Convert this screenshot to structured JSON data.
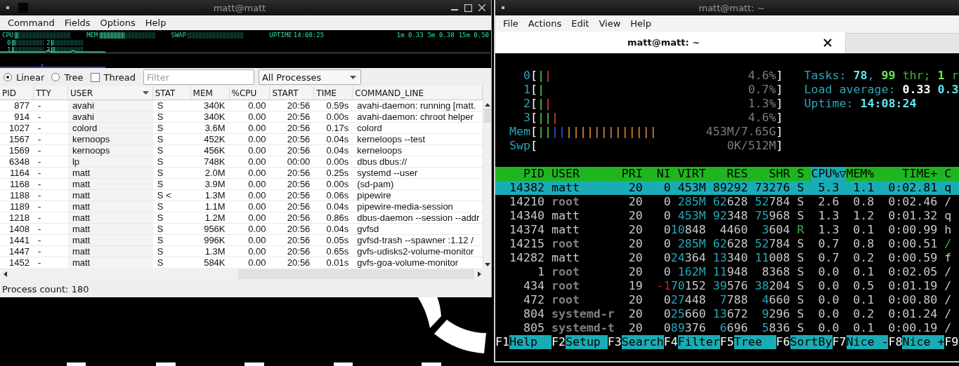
{
  "left_window": {
    "title": "matt@matt",
    "menu": [
      "Command",
      "Fields",
      "Options",
      "Help"
    ],
    "monitor": {
      "meters": [
        {
          "label": "CPU",
          "level": 0.06
        },
        {
          "label": "MEM",
          "level": 0.45
        },
        {
          "label": "SWAP"
        }
      ],
      "uptime_label": "UPTIME",
      "uptime": "14:08:25",
      "load": [
        "1m 0.33",
        "5m 0.38",
        "15m 0.50"
      ],
      "cores": [
        {
          "label": "0",
          "level": 0.1
        },
        {
          "label": "1",
          "level": 0.05
        },
        {
          "label": "2",
          "level": 0.08
        },
        {
          "label": "3",
          "level": 0.1
        }
      ]
    },
    "view_modes": [
      {
        "label": "Linear",
        "selected": true
      },
      {
        "label": "Tree",
        "selected": false
      }
    ],
    "thread": {
      "label": "Thread",
      "checked": false
    },
    "filter": {
      "placeholder": "Filter"
    },
    "process_filter": "All Processes",
    "table": {
      "columns": [
        {
          "label": "PID",
          "sorted": false
        },
        {
          "label": "TTY",
          "sorted": false
        },
        {
          "label": "USER",
          "sorted": true
        },
        {
          "label": "STAT",
          "sorted": false
        },
        {
          "label": "MEM",
          "sorted": false
        },
        {
          "label": "%CPU",
          "sorted": false
        },
        {
          "label": "START",
          "sorted": false
        },
        {
          "label": "TIME",
          "sorted": false
        },
        {
          "label": "COMMAND_LINE",
          "sorted": false
        }
      ],
      "rows": [
        [
          "877",
          "-",
          "avahi",
          "S",
          "340K",
          "0.00",
          "20:56",
          "0.59s",
          "avahi-daemon: running [matt."
        ],
        [
          "914",
          "-",
          "avahi",
          "S",
          "340K",
          "0.00",
          "20:56",
          "0.00s",
          "avahi-daemon: chroot helper"
        ],
        [
          "1027",
          "-",
          "colord",
          "S",
          "3.6M",
          "0.00",
          "20:56",
          "0.17s",
          "colord"
        ],
        [
          "1567",
          "-",
          "kernoops",
          "S",
          "452K",
          "0.00",
          "20:56",
          "0.04s",
          "kerneloops --test"
        ],
        [
          "1569",
          "-",
          "kernoops",
          "S",
          "456K",
          "0.00",
          "20:56",
          "0.04s",
          "kerneloops"
        ],
        [
          "6348",
          "-",
          "lp",
          "S",
          "748K",
          "0.00",
          "00:00",
          "0.00s",
          "dbus dbus://"
        ],
        [
          "1164",
          "-",
          "matt",
          "S",
          "2.0M",
          "0.00",
          "20:56",
          "0.25s",
          "systemd --user"
        ],
        [
          "1168",
          "-",
          "matt",
          "S",
          "3.9M",
          "0.00",
          "20:56",
          "0.00s",
          "(sd-pam)"
        ],
        [
          "1188",
          "-",
          "matt",
          "S <",
          "1.3M",
          "0.00",
          "20:56",
          "0.06s",
          "pipewire"
        ],
        [
          "1189",
          "-",
          "matt",
          "S",
          "1.1M",
          "0.00",
          "20:56",
          "0.04s",
          "pipewire-media-session"
        ],
        [
          "1218",
          "-",
          "matt",
          "S",
          "1.2M",
          "0.00",
          "20:56",
          "0.86s",
          "dbus-daemon --session --addr"
        ],
        [
          "1408",
          "-",
          "matt",
          "S",
          "956K",
          "0.00",
          "20:56",
          "0.04s",
          "gvfsd"
        ],
        [
          "1441",
          "-",
          "matt",
          "S",
          "996K",
          "0.00",
          "20:56",
          "0.05s",
          "gvfsd-trash --spawner :1.12 /"
        ],
        [
          "1447",
          "-",
          "matt",
          "S",
          "1.3M",
          "0.00",
          "20:56",
          "0.65s",
          "gvfs-udisks2-volume-monitor"
        ],
        [
          "1452",
          "-",
          "matt",
          "S",
          "584K",
          "0.00",
          "20:56",
          "0.01s",
          "gvfs-goa-volume-monitor"
        ]
      ]
    },
    "status": "Process count: 180"
  },
  "right_window": {
    "title": "matt@matt: ~",
    "menu": [
      "File",
      "Actions",
      "Edit",
      "View",
      "Help"
    ],
    "tabs": [
      {
        "label": "matt@matt: ~",
        "selected": true
      },
      {
        "selected": false
      }
    ],
    "htop": {
      "meters": [
        {
          "label": "0",
          "open": "[",
          "bars": [
            {
              "text": "|",
              "color": "#3cb43c"
            },
            {
              "text": "|",
              "color": "#c8322d"
            }
          ],
          "value": "4.6%",
          "close": "]"
        },
        {
          "label": "1",
          "open": "[",
          "bars": [
            {
              "text": "|",
              "color": "#3cb43c"
            }
          ],
          "value": "0.7%",
          "close": "]"
        },
        {
          "label": "2",
          "open": "[",
          "bars": [
            {
              "text": "|",
              "color": "#3cb43c"
            },
            {
              "text": "|",
              "color": "#c8322d"
            }
          ],
          "value": "1.3%",
          "close": "]"
        },
        {
          "label": "3",
          "open": "[",
          "bars": [
            {
              "text": "||",
              "color": "#3cb43c"
            },
            {
              "text": "|",
              "color": "#c8322d"
            }
          ],
          "value": "4.6%",
          "close": "]"
        },
        {
          "label": "Mem",
          "open": "[",
          "bars": [
            {
              "text": "||",
              "color": "#3cb43c"
            },
            {
              "text": "||",
              "color": "#2f3fd0"
            },
            {
              "text": "|||||||||||||",
              "color": "#c27a2c"
            }
          ],
          "value": "453M/7.65G",
          "close": "]"
        },
        {
          "label": "Swp",
          "open": "[",
          "value": "0K/512M",
          "close": "]"
        }
      ],
      "info": [
        [
          {
            "text": "Tasks: ",
            "color": "#2aa5b5",
            "bold": false
          },
          {
            "text": "78",
            "color": "#5ee8f0",
            "bold": true
          },
          {
            "text": ", ",
            "color": "#2aa5b5",
            "bold": false
          },
          {
            "text": "99",
            "color": "#6ee35a",
            "bold": true
          },
          {
            "text": " thr; ",
            "color": "#3cb43c",
            "bold": false
          },
          {
            "text": "1",
            "color": "#6ee35a",
            "bold": true
          },
          {
            "text": " r",
            "color": "#3cb43c",
            "bold": false
          }
        ],
        [
          {
            "text": "Load average: ",
            "color": "#2aa5b5",
            "bold": false
          },
          {
            "text": "0.33",
            "color": "#ffffff",
            "bold": true
          },
          {
            "text": " 0.3",
            "color": "#5ee8f0",
            "bold": true
          }
        ],
        [
          {
            "text": "Uptime: ",
            "color": "#2aa5b5",
            "bold": false
          },
          {
            "text": "14:08:24",
            "color": "#5ee8f0",
            "bold": true
          }
        ]
      ],
      "header": [
        {
          "label": "PID",
          "selected": false
        },
        {
          "label": "USER",
          "selected": false
        },
        {
          "label": "PRI",
          "selected": false
        },
        {
          "label": "NI",
          "selected": false
        },
        {
          "label": "VIRT",
          "selected": false
        },
        {
          "label": "RES",
          "selected": false
        },
        {
          "label": "SHR",
          "selected": false
        },
        {
          "label": "S",
          "selected": false
        },
        {
          "label": "CPU%▽",
          "selected": true
        },
        {
          "label": "MEM%",
          "selected": false
        },
        {
          "label": "TIME+",
          "selected": false
        },
        {
          "label": "C",
          "selected": false
        }
      ],
      "processes": [
        {
          "selected": true,
          "pid": "14382",
          "user": "matt",
          "pri": "20",
          "ni": "0",
          "virt": {
            "lo": "453M"
          },
          "res": {
            "lo": "89292"
          },
          "shr": {
            "lo": "73276"
          },
          "s": "S",
          "cpu": "5.3",
          "mem": "1.1",
          "time": "0:02.81",
          "cmd": "q"
        },
        {
          "selected": false,
          "dim_user": true,
          "running": false,
          "negative_nice": false,
          "cmd_highlight": false,
          "pid": "14210",
          "user": "root",
          "pri": "20",
          "ni": "0",
          "virt": {
            "hi": "285M"
          },
          "res": {
            "hi": "62",
            "lo": "628"
          },
          "shr": {
            "hi": "52",
            "lo": "784"
          },
          "s": "S",
          "cpu": "2.6",
          "mem": "0.8",
          "time": "0:02.46",
          "cmd": "/"
        },
        {
          "selected": false,
          "dim_user": false,
          "running": false,
          "negative_nice": false,
          "cmd_highlight": false,
          "pid": "14340",
          "user": "matt",
          "pri": "20",
          "ni": "0",
          "virt": {
            "hi": "453M"
          },
          "res": {
            "hi": "92",
            "lo": "348"
          },
          "shr": {
            "hi": "75",
            "lo": "968"
          },
          "s": "S",
          "cpu": "1.3",
          "mem": "1.2",
          "time": "0:01.32",
          "cmd": "q"
        },
        {
          "selected": false,
          "dim_user": false,
          "running": true,
          "negative_nice": false,
          "cmd_highlight": false,
          "pid": "14374",
          "user": "matt",
          "pri": "20",
          "ni": "0",
          "virt": {
            "hi": "10",
            "lo": "848"
          },
          "res": {
            "lo": "4460"
          },
          "shr": {
            "hi": "3",
            "lo": "604"
          },
          "s": "R",
          "cpu": "1.3",
          "mem": "0.1",
          "time": "0:00.99",
          "cmd": "h"
        },
        {
          "selected": false,
          "dim_user": true,
          "running": false,
          "negative_nice": false,
          "cmd_highlight": true,
          "pid": "14215",
          "user": "root",
          "pri": "20",
          "ni": "0",
          "virt": {
            "hi": "285M"
          },
          "res": {
            "hi": "62",
            "lo": "628"
          },
          "shr": {
            "hi": "52",
            "lo": "784"
          },
          "s": "S",
          "cpu": "0.7",
          "mem": "0.8",
          "time": "0:00.51",
          "cmd": "/"
        },
        {
          "selected": false,
          "dim_user": false,
          "running": false,
          "negative_nice": false,
          "cmd_highlight": false,
          "pid": "14282",
          "user": "matt",
          "pri": "20",
          "ni": "0",
          "virt": {
            "hi": "24",
            "lo": "364"
          },
          "res": {
            "hi": "13",
            "lo": "340"
          },
          "shr": {
            "hi": "11",
            "lo": "008"
          },
          "s": "S",
          "cpu": "0.7",
          "mem": "0.2",
          "time": "0:00.59",
          "cmd": "f"
        },
        {
          "selected": false,
          "dim_user": true,
          "running": false,
          "negative_nice": false,
          "cmd_highlight": false,
          "pid": "1",
          "user": "root",
          "pri": "20",
          "ni": "0",
          "virt": {
            "hi": "162M"
          },
          "res": {
            "hi": "11",
            "lo": "948"
          },
          "shr": {
            "lo": "8368"
          },
          "s": "S",
          "cpu": "0.0",
          "mem": "0.1",
          "time": "0:02.05",
          "cmd": "/"
        },
        {
          "selected": false,
          "dim_user": true,
          "running": false,
          "negative_nice": true,
          "cmd_highlight": false,
          "pid": "434",
          "user": "root",
          "pri": "19",
          "ni": "-1",
          "virt": {
            "hi": "70",
            "lo": "152"
          },
          "res": {
            "hi": "39",
            "lo": "576"
          },
          "shr": {
            "hi": "38",
            "lo": "204"
          },
          "s": "S",
          "cpu": "0.0",
          "mem": "0.5",
          "time": "0:01.19",
          "cmd": "/"
        },
        {
          "selected": false,
          "dim_user": true,
          "running": false,
          "negative_nice": false,
          "cmd_highlight": false,
          "pid": "472",
          "user": "root",
          "pri": "20",
          "ni": "0",
          "virt": {
            "hi": "27",
            "lo": "448"
          },
          "res": {
            "hi": "7",
            "lo": "788"
          },
          "shr": {
            "hi": "4",
            "lo": "660"
          },
          "s": "S",
          "cpu": "0.0",
          "mem": "0.1",
          "time": "0:00.80",
          "cmd": "/"
        },
        {
          "selected": false,
          "dim_user": true,
          "running": false,
          "negative_nice": false,
          "cmd_highlight": false,
          "pid": "804",
          "user": "systemd-r",
          "pri": "20",
          "ni": "0",
          "virt": {
            "hi": "25",
            "lo": "660"
          },
          "res": {
            "hi": "13",
            "lo": "672"
          },
          "shr": {
            "hi": "9",
            "lo": "296"
          },
          "s": "S",
          "cpu": "0.0",
          "mem": "0.2",
          "time": "0:01.24",
          "cmd": "/"
        },
        {
          "selected": false,
          "dim_user": true,
          "running": false,
          "negative_nice": false,
          "cmd_highlight": false,
          "pid": "805",
          "user": "systemd-t",
          "pri": "20",
          "ni": "0",
          "virt": {
            "hi": "89",
            "lo": "376"
          },
          "res": {
            "hi": "6",
            "lo": "696"
          },
          "shr": {
            "hi": "5",
            "lo": "836"
          },
          "s": "S",
          "cpu": "0.0",
          "mem": "0.1",
          "time": "0:00.19",
          "cmd": "/"
        }
      ],
      "keys": [
        {
          "key": "F1",
          "label": "Help"
        },
        {
          "key": "F2",
          "label": "Setup"
        },
        {
          "key": "F3",
          "label": "Search"
        },
        {
          "key": "F4",
          "label": "Filter"
        },
        {
          "key": "F5",
          "label": "Tree"
        },
        {
          "key": "F6",
          "label": "SortBy"
        },
        {
          "key": "F7",
          "label": "Nice -"
        },
        {
          "key": "F8",
          "label": "Nice +"
        },
        {
          "key": "F9"
        }
      ]
    }
  }
}
